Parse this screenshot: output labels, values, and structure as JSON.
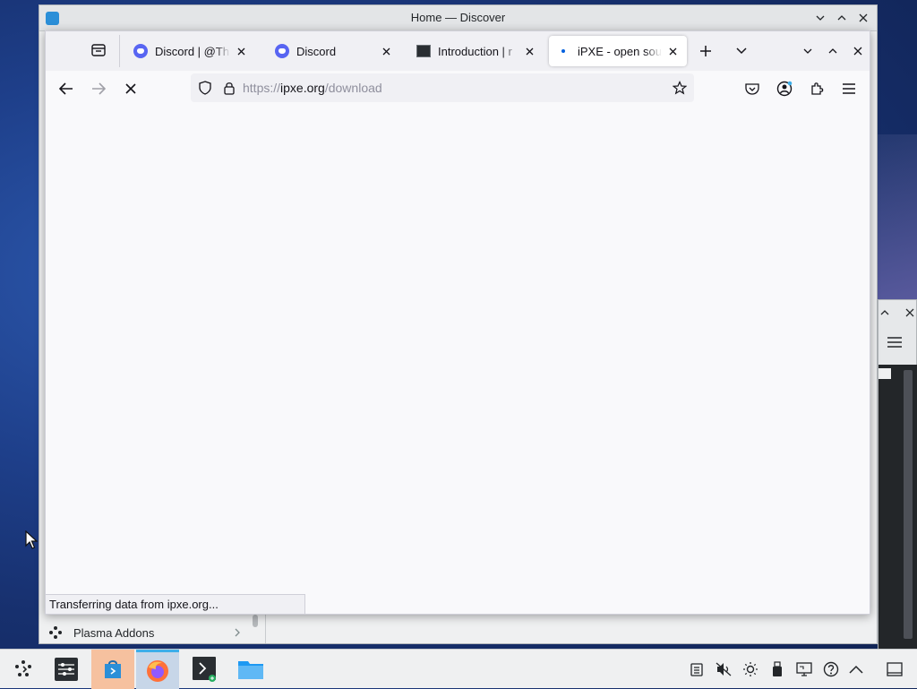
{
  "discover": {
    "title": "Home — Discover",
    "sidebar_item": "Plasma Addons"
  },
  "firefox": {
    "tabs": [
      {
        "title": "Discord | @Tha",
        "icon": "discord-icon"
      },
      {
        "title": "Discord",
        "icon": "discord-icon"
      },
      {
        "title": "Introduction | r",
        "icon": "terminal-icon"
      },
      {
        "title": "iPXE - open sou",
        "icon": "loading-dot-icon",
        "active": true
      }
    ],
    "url_prefix": "https://",
    "url_host": "ipxe.org",
    "url_path": "/download",
    "status": "Transferring data from ipxe.org..."
  },
  "taskbar": {
    "apps": [
      "application-launcher",
      "system-settings",
      "discover",
      "firefox",
      "konsole",
      "dolphin"
    ],
    "tray": [
      "clipboard-icon",
      "volume-muted-icon",
      "brightness-icon",
      "usb-icon",
      "display-icon",
      "help-icon",
      "show-hidden-icon",
      "show-desktop-icon"
    ]
  },
  "colors": {
    "accent": "#3daee9",
    "firefox_blue": "#0060df",
    "discord": "#5865f2"
  }
}
